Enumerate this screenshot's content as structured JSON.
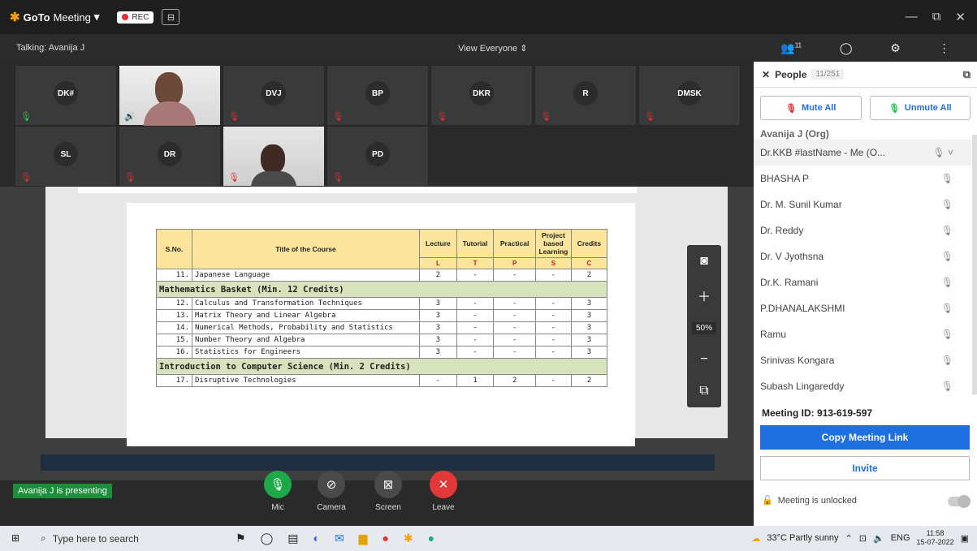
{
  "app": {
    "brand_a": "GoTo",
    "brand_b": "Meeting",
    "rec_label": "REC"
  },
  "topbar": {
    "talking": "Talking: Avanija J",
    "view": "View Everyone",
    "people_count": "11"
  },
  "tiles": [
    {
      "initials": "DK#",
      "mic": "on"
    },
    {
      "initials": "",
      "mic": "on",
      "photo": true
    },
    {
      "initials": "DVJ",
      "mic": "off"
    },
    {
      "initials": "BP",
      "mic": "off"
    },
    {
      "initials": "DKR",
      "mic": "off"
    },
    {
      "initials": "R",
      "mic": "off"
    },
    {
      "initials": "DMSK",
      "mic": "off"
    },
    {
      "initials": "SL",
      "mic": "off"
    },
    {
      "initials": "DR",
      "mic": "off"
    },
    {
      "initials": "",
      "mic": "off",
      "photo": true
    },
    {
      "initials": "PD",
      "mic": "off"
    }
  ],
  "table": {
    "headers": [
      "S.No.",
      "Title of the Course",
      "Lecture",
      "Tutorial",
      "Practical",
      "Project based Learning",
      "Credits"
    ],
    "sub": [
      "L",
      "T",
      "P",
      "S",
      "C"
    ],
    "row11": [
      "11.",
      "Japanese Language",
      "2",
      "-",
      "-",
      "-",
      "2"
    ],
    "basket1": "Mathematics Basket (Min. 12 Credits)",
    "rows": [
      [
        "12.",
        "Calculus and Transformation Techniques",
        "3",
        "-",
        "-",
        "-",
        "3"
      ],
      [
        "13.",
        "Matrix Theory and Linear Algebra",
        "3",
        "-",
        "-",
        "-",
        "3"
      ],
      [
        "14.",
        "Numerical Methods, Probability and Statistics",
        "3",
        "-",
        "-",
        "-",
        "3"
      ],
      [
        "15.",
        "Number Theory and Algebra",
        "3",
        "-",
        "-",
        "-",
        "3"
      ],
      [
        "16.",
        "Statistics for Engineers",
        "3",
        "-",
        "-",
        "-",
        "3"
      ]
    ],
    "basket2": "Introduction to Computer Science (Min. 2 Credits)",
    "row17": [
      "17.",
      "Disruptive Technologies",
      "-",
      "1",
      "2",
      "-",
      "2"
    ]
  },
  "zoom": {
    "pct": "50%"
  },
  "controls": {
    "presenting": "Avanija J is presenting",
    "mic": "Mic",
    "camera": "Camera",
    "screen": "Screen",
    "leave": "Leave"
  },
  "panel": {
    "title": "People",
    "count": "11/251",
    "mute_all": "Mute All",
    "unmute_all": "Unmute All",
    "cut_row": "Avanija J (Org)",
    "people": [
      "Dr.KKB #lastName - Me (O...",
      "BHASHA P",
      "Dr. M. Sunil Kumar",
      "Dr. Reddy",
      "Dr. V Jyothsna",
      "Dr.K. Ramani",
      "P.DHANALAKSHMI",
      "Ramu",
      "Srinivas Kongara",
      "Subash Lingareddy"
    ],
    "meeting_id_label": "Meeting ID:",
    "meeting_id": "913-619-597",
    "copy_link": "Copy Meeting Link",
    "invite": "Invite",
    "unlocked": "Meeting is unlocked"
  },
  "taskbar": {
    "search_placeholder": "Type here to search",
    "weather": "33°C Partly sunny",
    "lang": "ENG",
    "time": "11:58",
    "date": "15-07-2022"
  }
}
